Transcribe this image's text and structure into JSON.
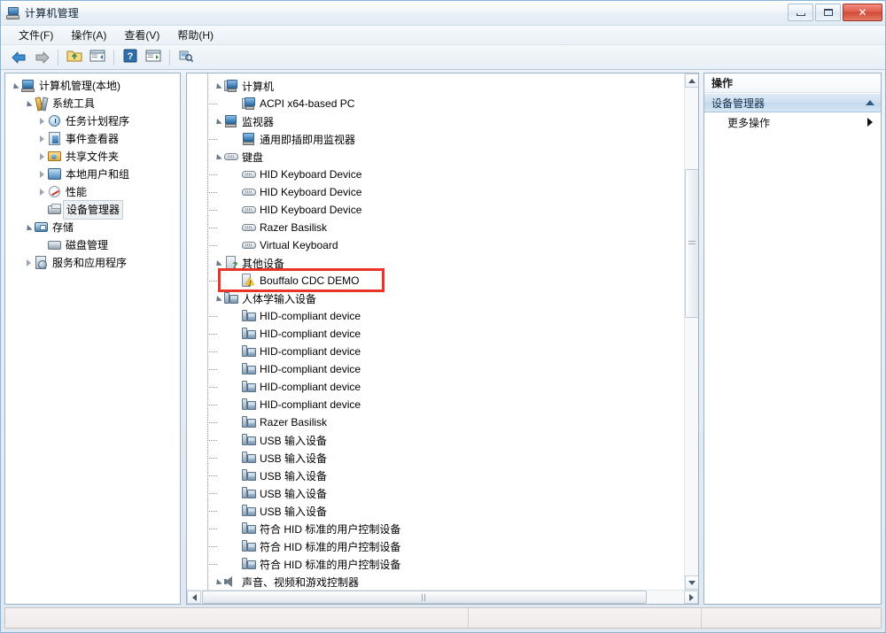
{
  "window": {
    "title": "计算机管理",
    "icon": "computer-management-icon",
    "caption": {
      "minimize": "–",
      "maximize": "□",
      "close": "✕"
    }
  },
  "menubar": {
    "items": [
      {
        "label": "文件(F)",
        "name": "menu-file"
      },
      {
        "label": "操作(A)",
        "name": "menu-action"
      },
      {
        "label": "查看(V)",
        "name": "menu-view"
      },
      {
        "label": "帮助(H)",
        "name": "menu-help"
      }
    ]
  },
  "toolbar": {
    "buttons": [
      {
        "name": "back-button",
        "icon": "arrow-left-icon",
        "title": "后退"
      },
      {
        "name": "forward-button",
        "icon": "arrow-right-icon",
        "title": "前进"
      },
      {
        "name": "up-folder-button",
        "icon": "folder-up-icon",
        "title": "向上"
      },
      {
        "name": "show-hide-tree-button",
        "icon": "panel-left-icon",
        "title": "显示/隐藏控制台树"
      },
      {
        "name": "help-button",
        "icon": "question-icon",
        "title": "帮助"
      },
      {
        "name": "show-action-pane-button",
        "icon": "panel-right-icon",
        "title": "显示/隐藏操作窗格"
      },
      {
        "name": "scan-hardware-changes-button",
        "icon": "scan-hardware-icon",
        "title": "扫描检测硬件改动"
      }
    ]
  },
  "left_tree": {
    "nodes": [
      {
        "label": "计算机管理(本地)",
        "icon": "computer-icon",
        "indent": 0,
        "twisty": "open",
        "selected": false
      },
      {
        "label": "系统工具",
        "icon": "tools-icon",
        "indent": 1,
        "twisty": "open",
        "selected": false
      },
      {
        "label": "任务计划程序",
        "icon": "clock-icon",
        "indent": 2,
        "twisty": "closed",
        "selected": false
      },
      {
        "label": "事件查看器",
        "icon": "event-viewer-icon",
        "indent": 2,
        "twisty": "closed",
        "selected": false
      },
      {
        "label": "共享文件夹",
        "icon": "shared-folder-icon",
        "indent": 2,
        "twisty": "closed",
        "selected": false
      },
      {
        "label": "本地用户和组",
        "icon": "users-icon",
        "indent": 2,
        "twisty": "closed",
        "selected": false
      },
      {
        "label": "性能",
        "icon": "performance-icon",
        "indent": 2,
        "twisty": "closed",
        "selected": false
      },
      {
        "label": "设备管理器",
        "icon": "device-manager-icon",
        "indent": 2,
        "twisty": "none",
        "selected": true
      },
      {
        "label": "存储",
        "icon": "storage-icon",
        "indent": 1,
        "twisty": "open",
        "selected": false
      },
      {
        "label": "磁盘管理",
        "icon": "disk-management-icon",
        "indent": 2,
        "twisty": "none",
        "selected": false
      },
      {
        "label": "服务和应用程序",
        "icon": "services-icon",
        "indent": 1,
        "twisty": "closed",
        "selected": false
      }
    ]
  },
  "device_tree": {
    "nodes": [
      {
        "label": "计算机",
        "icon": "computer-icon",
        "level": 1,
        "twisty": "open",
        "highlight": false
      },
      {
        "label": "ACPI x64-based PC",
        "icon": "computer-icon",
        "level": 2,
        "twisty": "none",
        "highlight": false
      },
      {
        "label": "监视器",
        "icon": "monitor-icon",
        "level": 1,
        "twisty": "open",
        "highlight": false
      },
      {
        "label": "通用即插即用监视器",
        "icon": "monitor-icon",
        "level": 2,
        "twisty": "none",
        "highlight": false
      },
      {
        "label": "键盘",
        "icon": "keyboard-icon",
        "level": 1,
        "twisty": "open",
        "highlight": false
      },
      {
        "label": "HID Keyboard Device",
        "icon": "keyboard-icon",
        "level": 2,
        "twisty": "none",
        "highlight": false
      },
      {
        "label": "HID Keyboard Device",
        "icon": "keyboard-icon",
        "level": 2,
        "twisty": "none",
        "highlight": false
      },
      {
        "label": "HID Keyboard Device",
        "icon": "keyboard-icon",
        "level": 2,
        "twisty": "none",
        "highlight": false
      },
      {
        "label": "Razer Basilisk",
        "icon": "keyboard-icon",
        "level": 2,
        "twisty": "none",
        "highlight": false
      },
      {
        "label": "Virtual Keyboard",
        "icon": "keyboard-icon",
        "level": 2,
        "twisty": "none",
        "highlight": false
      },
      {
        "label": "其他设备",
        "icon": "other-device-icon",
        "level": 1,
        "twisty": "open",
        "highlight": false
      },
      {
        "label": "Bouffalo CDC DEMO",
        "icon": "unknown-device-warning-icon",
        "level": 2,
        "twisty": "none",
        "highlight": true
      },
      {
        "label": "人体学输入设备",
        "icon": "hid-icon",
        "level": 1,
        "twisty": "open",
        "highlight": false
      },
      {
        "label": "HID-compliant device",
        "icon": "hid-icon",
        "level": 2,
        "twisty": "none",
        "highlight": false
      },
      {
        "label": "HID-compliant device",
        "icon": "hid-icon",
        "level": 2,
        "twisty": "none",
        "highlight": false
      },
      {
        "label": "HID-compliant device",
        "icon": "hid-icon",
        "level": 2,
        "twisty": "none",
        "highlight": false
      },
      {
        "label": "HID-compliant device",
        "icon": "hid-icon",
        "level": 2,
        "twisty": "none",
        "highlight": false
      },
      {
        "label": "HID-compliant device",
        "icon": "hid-icon",
        "level": 2,
        "twisty": "none",
        "highlight": false
      },
      {
        "label": "HID-compliant device",
        "icon": "hid-icon",
        "level": 2,
        "twisty": "none",
        "highlight": false
      },
      {
        "label": "Razer Basilisk",
        "icon": "hid-icon",
        "level": 2,
        "twisty": "none",
        "highlight": false
      },
      {
        "label": "USB 输入设备",
        "icon": "hid-icon",
        "level": 2,
        "twisty": "none",
        "highlight": false
      },
      {
        "label": "USB 输入设备",
        "icon": "hid-icon",
        "level": 2,
        "twisty": "none",
        "highlight": false
      },
      {
        "label": "USB 输入设备",
        "icon": "hid-icon",
        "level": 2,
        "twisty": "none",
        "highlight": false
      },
      {
        "label": "USB 输入设备",
        "icon": "hid-icon",
        "level": 2,
        "twisty": "none",
        "highlight": false
      },
      {
        "label": "USB 输入设备",
        "icon": "hid-icon",
        "level": 2,
        "twisty": "none",
        "highlight": false
      },
      {
        "label": "符合 HID 标准的用户控制设备",
        "icon": "hid-icon",
        "level": 2,
        "twisty": "none",
        "highlight": false
      },
      {
        "label": "符合 HID 标准的用户控制设备",
        "icon": "hid-icon",
        "level": 2,
        "twisty": "none",
        "highlight": false
      },
      {
        "label": "符合 HID 标准的用户控制设备",
        "icon": "hid-icon",
        "level": 2,
        "twisty": "none",
        "highlight": false
      },
      {
        "label": "声音、视频和游戏控制器",
        "icon": "sound-icon",
        "level": 1,
        "twisty": "open",
        "highlight": false
      }
    ],
    "annotation": {
      "type": "red-rectangle",
      "color": "#e8352a",
      "target_label": "Bouffalo CDC DEMO"
    }
  },
  "actions_pane": {
    "header": "操作",
    "section_title": "设备管理器",
    "section_collapse_icon": "chevron-up-icon",
    "items": [
      {
        "label": "更多操作",
        "name": "action-more-actions",
        "submenu_icon": "chevron-right-icon"
      }
    ]
  },
  "statusbar": {
    "cells": [
      "",
      "",
      ""
    ]
  }
}
